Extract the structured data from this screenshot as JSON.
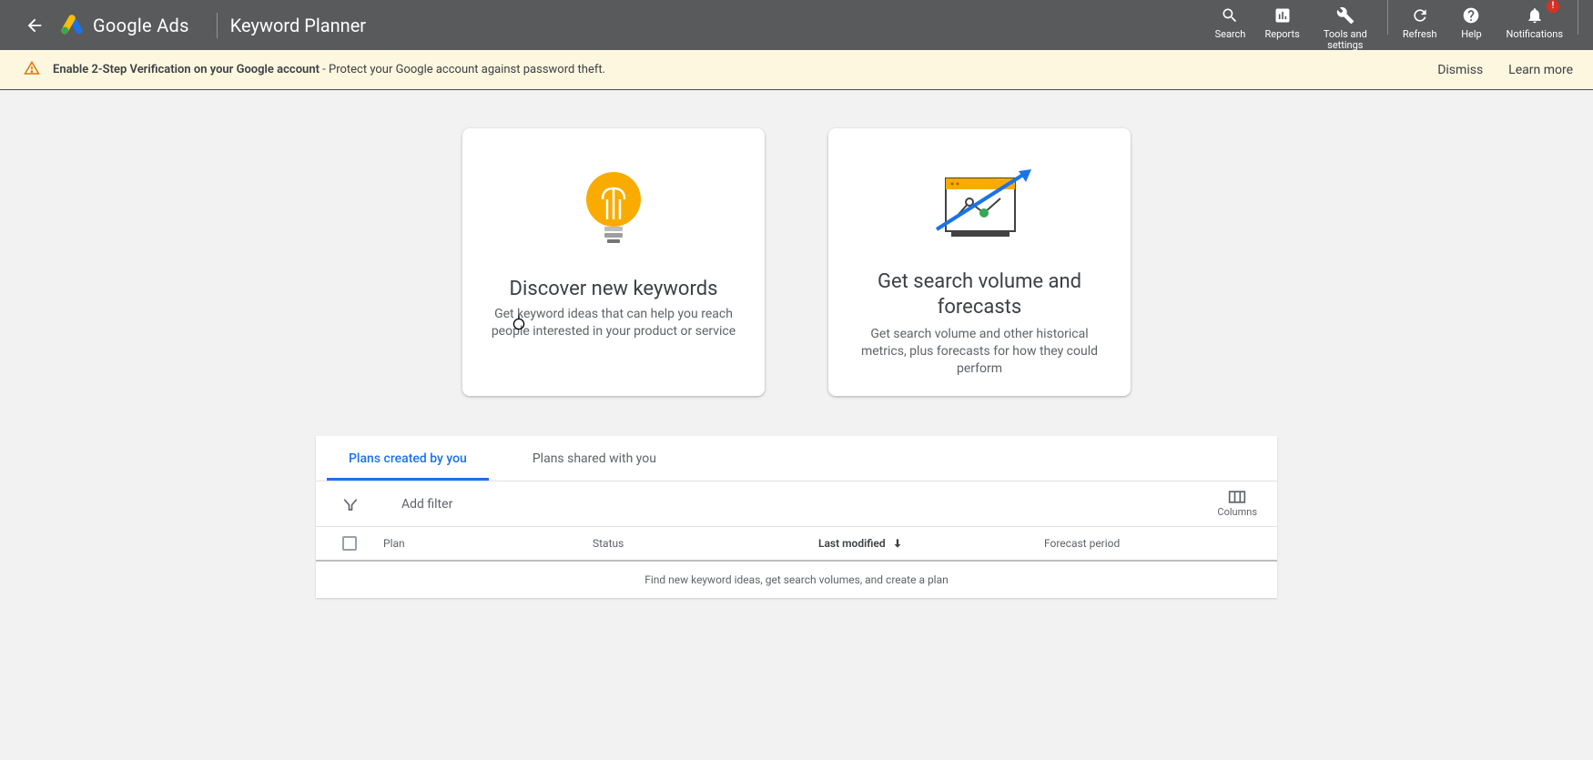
{
  "header": {
    "product": "Google Ads",
    "page": "Keyword Planner",
    "actions": {
      "search": "Search",
      "reports": "Reports",
      "tools": "Tools and settings",
      "refresh": "Refresh",
      "help": "Help",
      "notifications": "Notifications",
      "notif_badge": "!"
    }
  },
  "banner": {
    "strong": "Enable 2-Step Verification on your Google account",
    "desc": " - Protect your Google account against password theft.",
    "dismiss": "Dismiss",
    "learn_more": "Learn more"
  },
  "cards": {
    "discover": {
      "title": "Discover new keywords",
      "desc": "Get keyword ideas that can help you reach people interested in your product or service"
    },
    "forecast": {
      "title": "Get search volume and forecasts",
      "desc": "Get search volume and other historical metrics, plus forecasts for how they could perform"
    }
  },
  "plans": {
    "tabs": {
      "created": "Plans created by you",
      "shared": "Plans shared with you"
    },
    "add_filter": "Add filter",
    "columns_label": "Columns",
    "headers": {
      "plan": "Plan",
      "status": "Status",
      "last_modified": "Last modified",
      "forecast_period": "Forecast period"
    },
    "empty": "Find new keyword ideas, get search volumes, and create a plan"
  }
}
